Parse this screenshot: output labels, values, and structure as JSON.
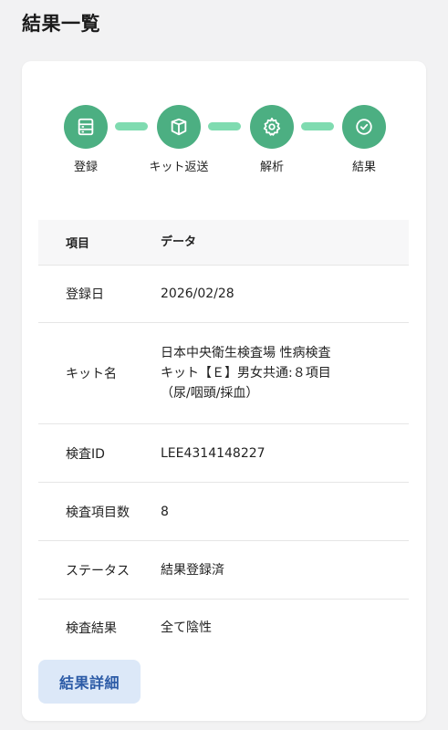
{
  "page": {
    "title": "結果一覧"
  },
  "colors": {
    "step_active": "#4caf82",
    "connector": "#7fdbb0",
    "button_bg": "#dce8f8",
    "button_text": "#2b5aa6"
  },
  "stepper": {
    "steps": [
      {
        "label": "登録",
        "icon": "form-icon"
      },
      {
        "label": "キット返送",
        "icon": "box-icon"
      },
      {
        "label": "解析",
        "icon": "gear-icon"
      },
      {
        "label": "結果",
        "icon": "check-circle-icon"
      }
    ]
  },
  "table": {
    "headers": {
      "item": "項目",
      "data": "データ"
    },
    "rows": [
      {
        "key": "登録日",
        "value": "2026/02/28"
      },
      {
        "key": "キット名",
        "value_lines": [
          "日本中央衛生検査場 性病検査",
          "キット【Ｅ】男女共通:８項目",
          "（尿/咽頭/採血）"
        ]
      },
      {
        "key": "検査ID",
        "value": "LEE4314148227"
      },
      {
        "key": "検査項目数",
        "value": "8"
      },
      {
        "key": "ステータス",
        "value": "結果登録済"
      },
      {
        "key": "検査結果",
        "value": "全て陰性"
      }
    ]
  },
  "actions": {
    "detail_label": "結果詳細"
  }
}
